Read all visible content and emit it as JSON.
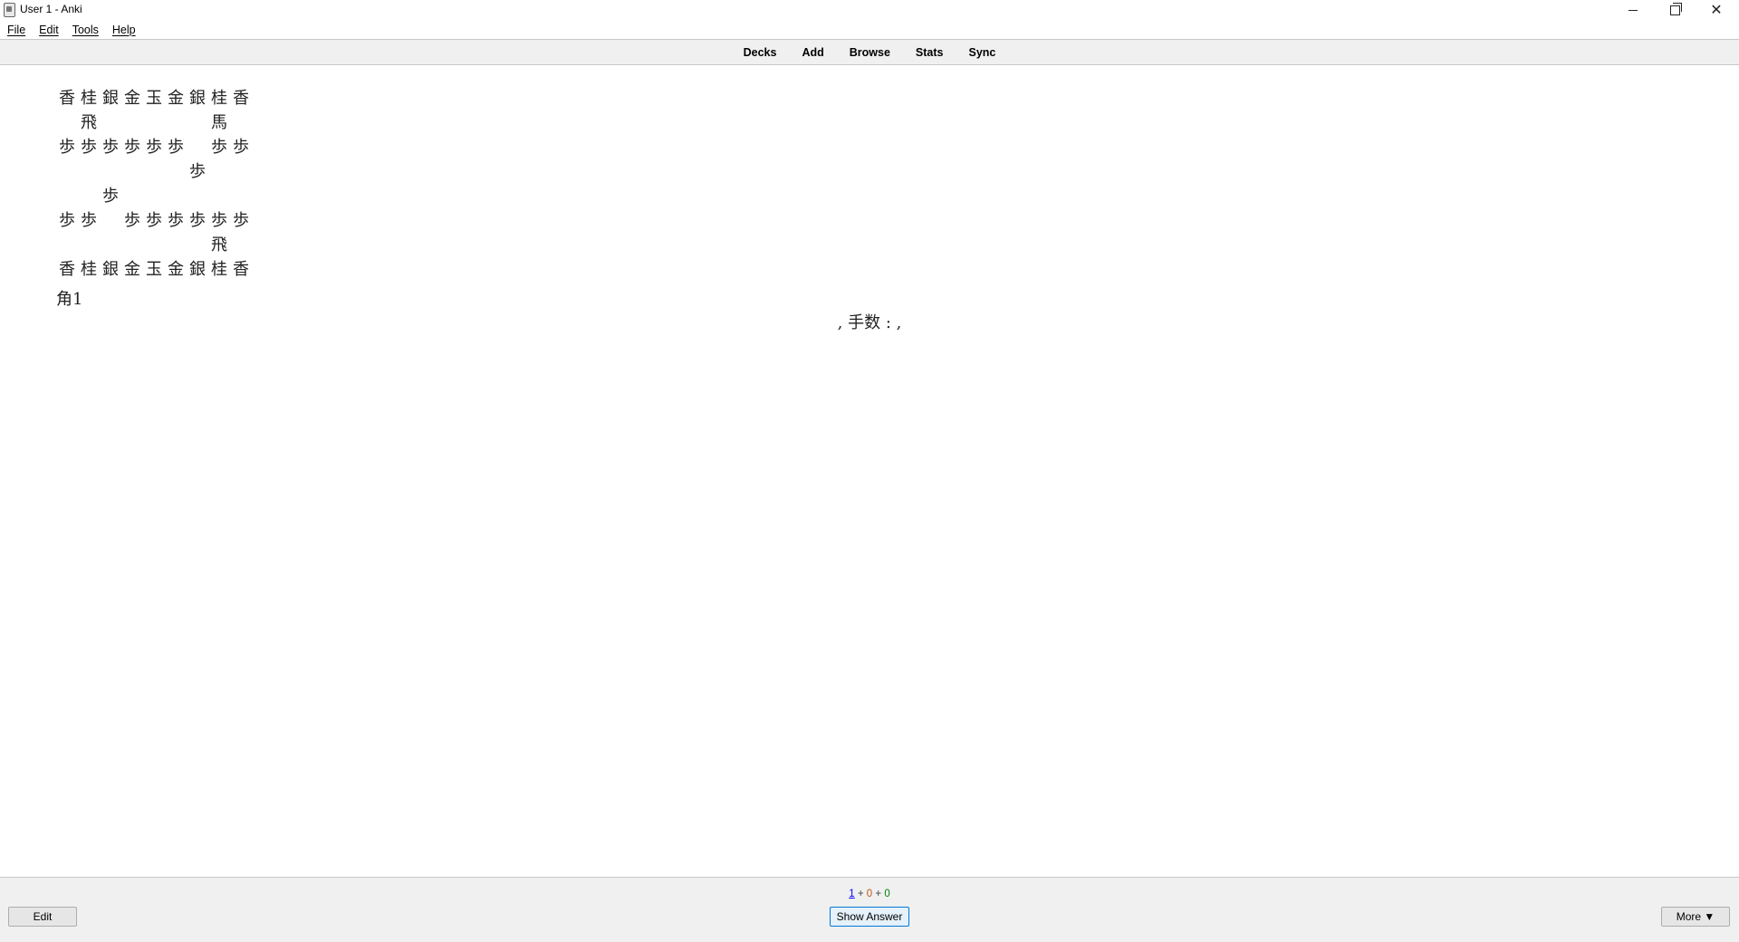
{
  "window": {
    "title": "User 1 - Anki",
    "controls": {
      "minimize": "—",
      "maximize": "▢",
      "close": "✕"
    }
  },
  "menu": {
    "items": [
      "File",
      "Edit",
      "Tools",
      "Help"
    ]
  },
  "toolbar": {
    "items": [
      "Decks",
      "Add",
      "Browse",
      "Stats",
      "Sync"
    ]
  },
  "card": {
    "board_rows": [
      [
        "香",
        "桂",
        "銀",
        "金",
        "玉",
        "金",
        "銀",
        "桂",
        "香"
      ],
      [
        "",
        "飛",
        "",
        "",
        "",
        "",
        "",
        "馬",
        ""
      ],
      [
        "歩",
        "歩",
        "歩",
        "歩",
        "歩",
        "歩",
        "",
        "歩",
        "歩"
      ],
      [
        "",
        "",
        "",
        "",
        "",
        "",
        "歩",
        "",
        ""
      ],
      [
        "",
        "",
        "歩",
        "",
        "",
        "",
        "",
        "",
        ""
      ],
      [
        "歩",
        "歩",
        "",
        "歩",
        "歩",
        "歩",
        "歩",
        "歩",
        "歩"
      ],
      [
        "",
        "",
        "",
        "",
        "",
        "",
        "",
        "飛",
        ""
      ],
      [
        "香",
        "桂",
        "銀",
        "金",
        "玉",
        "金",
        "銀",
        "桂",
        "香"
      ]
    ],
    "hand": "角1",
    "move_count_label": ", 手数 : ,"
  },
  "counts": {
    "new": "1",
    "sep1": " + ",
    "learn": "0",
    "sep2": " + ",
    "review": "0"
  },
  "buttons": {
    "edit": "Edit",
    "show_answer": "Show Answer",
    "more": "More ▼"
  }
}
